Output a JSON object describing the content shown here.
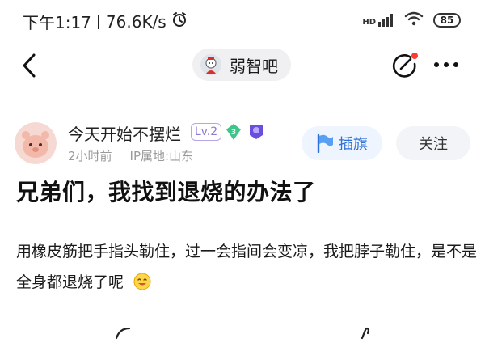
{
  "status_bar": {
    "time": "下午1:17",
    "network_speed": "76.6K/s",
    "network_type": "HD",
    "battery": "85",
    "icons": [
      "alarm-icon",
      "signal-icon",
      "wifi-icon",
      "battery-icon"
    ]
  },
  "nav": {
    "forum_name": "弱智吧",
    "icons": [
      "back-icon",
      "edit-icon",
      "more-icon"
    ],
    "notify_dot_color": "#ff3b30"
  },
  "author": {
    "name": "今天开始不摆烂",
    "level": "Lv.2",
    "gem_value": "3",
    "time_ago": "2小时前",
    "ip_location": "IP属地:山东"
  },
  "actions": {
    "flag_label": "插旗",
    "follow_label": "关注"
  },
  "post": {
    "title": "兄弟们，我找到退烧的办法了",
    "body": "用橡皮筋把手指头勒住，过一会指间会变凉，我把脖子勒住，是不是全身都退烧了呢"
  },
  "colors": {
    "accent_blue": "#2f6fd8",
    "level_purple": "#8d79d6",
    "gem_green": "#3fc48a",
    "member_purple": "#6b4de0"
  }
}
